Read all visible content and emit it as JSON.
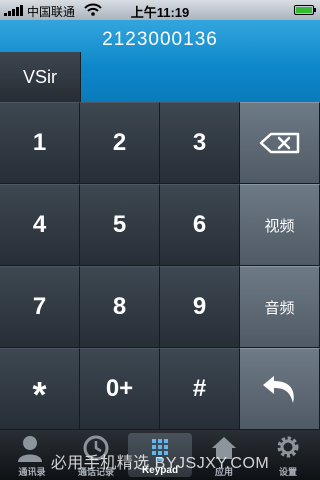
{
  "status_bar": {
    "carrier": "中国联通",
    "time": "上午11:19"
  },
  "display": {
    "number": "2123000136",
    "contact_tab": "VSir"
  },
  "keypad": {
    "keys": [
      "1",
      "2",
      "3",
      "4",
      "5",
      "6",
      "7",
      "8",
      "9",
      "*",
      "0+",
      "#"
    ],
    "video_label": "视频",
    "audio_label": "音频"
  },
  "tab_bar": {
    "items": [
      {
        "label": "通讯录",
        "icon": "contacts-icon"
      },
      {
        "label": "通话记录",
        "icon": "clock-icon"
      },
      {
        "label": "Keypad",
        "icon": "keypad-icon"
      },
      {
        "label": "应用",
        "icon": "home-icon"
      },
      {
        "label": "设置",
        "icon": "gear-icon"
      }
    ],
    "active": 2
  },
  "watermark": "必用手机精选 BYJSJXY.COM"
}
